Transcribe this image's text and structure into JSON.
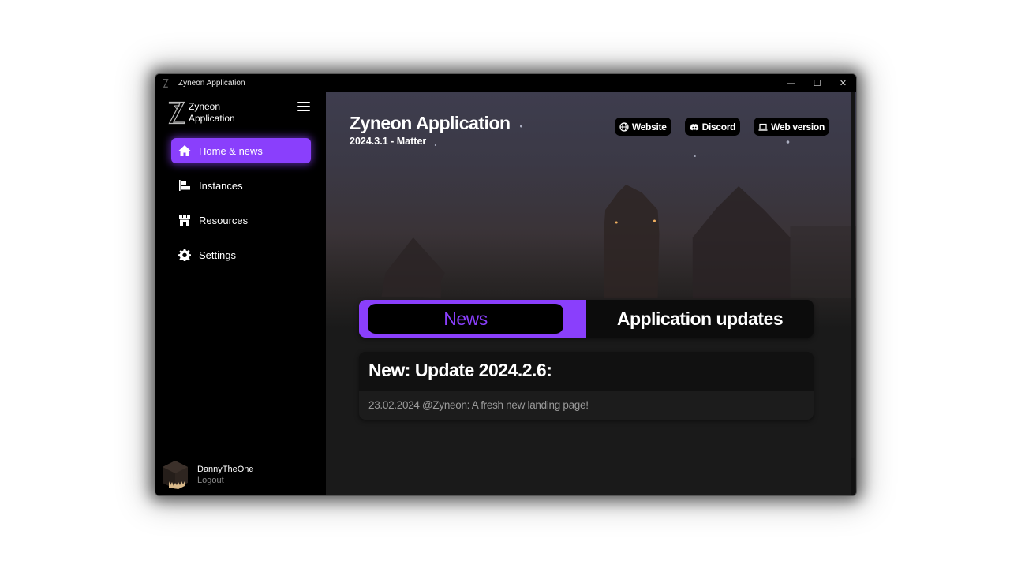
{
  "window": {
    "title": "Zyneon Application",
    "controls": {
      "minimize": "—",
      "maximize": "☐",
      "close": "✕"
    }
  },
  "sidebar": {
    "brand": {
      "line1": "Zyneon",
      "line2": "Application",
      "icon": "zyneon-logo-icon"
    },
    "menu_icon": "hamburger-menu-icon",
    "items": [
      {
        "label": "Home & news",
        "icon": "home-icon",
        "active": true
      },
      {
        "label": "Instances",
        "icon": "instances-icon",
        "active": false
      },
      {
        "label": "Resources",
        "icon": "store-icon",
        "active": false
      },
      {
        "label": "Settings",
        "icon": "gear-icon",
        "active": false
      }
    ],
    "user": {
      "name": "DannyTheOne",
      "logout": "Logout"
    }
  },
  "main": {
    "title": "Zyneon Application",
    "version": "2024.3.1 - Matter",
    "links": [
      {
        "label": "Website",
        "icon": "globe-icon"
      },
      {
        "label": "Discord",
        "icon": "discord-icon"
      },
      {
        "label": "Web version",
        "icon": "laptop-icon"
      }
    ],
    "tabs": [
      {
        "label": "News",
        "active": true
      },
      {
        "label": "Application updates",
        "active": false
      }
    ],
    "news": {
      "title": "New: Update 2024.2.6:",
      "body": "23.02.2024 @Zyneon: A fresh new landing page!"
    }
  },
  "colors": {
    "accent": "#8a3ffc",
    "background": "#1a1a1a",
    "sidebar": "#000000"
  }
}
